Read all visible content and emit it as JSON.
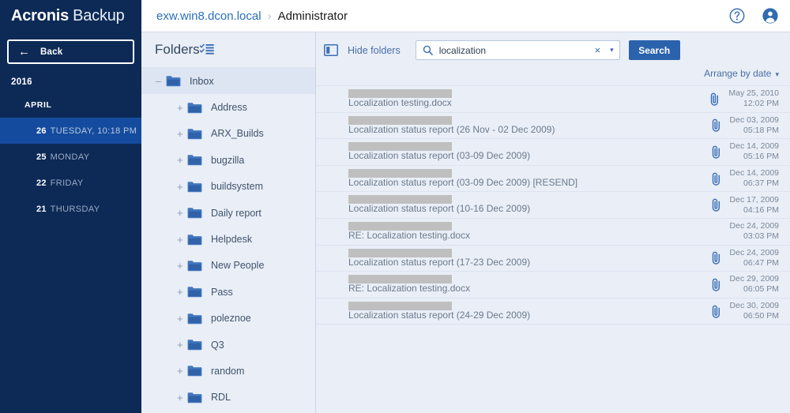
{
  "brand": {
    "name_bold": "Acronis",
    "name_light": "Backup"
  },
  "header": {
    "breadcrumb_link": "exw.win8.dcon.local",
    "breadcrumb_separator": "›",
    "breadcrumb_current": "Administrator",
    "help_icon": "question-circle-icon",
    "account_icon": "user-avatar-icon"
  },
  "sidebar": {
    "back_label": "Back",
    "back_icon": "arrow-left-icon",
    "year": "2016",
    "month": "APRIL",
    "days": [
      {
        "num": "26",
        "text": "TUESDAY, 10:18 PM",
        "selected": true
      },
      {
        "num": "25",
        "text": "MONDAY",
        "selected": false
      },
      {
        "num": "22",
        "text": "FRIDAY",
        "selected": false
      },
      {
        "num": "21",
        "text": "THURSDAY",
        "selected": false
      }
    ]
  },
  "folders": {
    "title": "Folders",
    "checklist_icon": "checklist-icon",
    "tree": [
      {
        "label": "Inbox",
        "expander": "–",
        "level": 0,
        "selected": true
      },
      {
        "label": "Address",
        "expander": "+",
        "level": 1,
        "selected": false
      },
      {
        "label": "ARX_Builds",
        "expander": "+",
        "level": 1,
        "selected": false
      },
      {
        "label": "bugzilla",
        "expander": "+",
        "level": 1,
        "selected": false
      },
      {
        "label": "buildsystem",
        "expander": "+",
        "level": 1,
        "selected": false
      },
      {
        "label": "Daily report",
        "expander": "+",
        "level": 1,
        "selected": false
      },
      {
        "label": "Helpdesk",
        "expander": "+",
        "level": 1,
        "selected": false
      },
      {
        "label": "New People",
        "expander": "+",
        "level": 1,
        "selected": false
      },
      {
        "label": "Pass",
        "expander": "+",
        "level": 1,
        "selected": false
      },
      {
        "label": "poleznoe",
        "expander": "+",
        "level": 1,
        "selected": false
      },
      {
        "label": "Q3",
        "expander": "+",
        "level": 1,
        "selected": false
      },
      {
        "label": "random",
        "expander": "+",
        "level": 1,
        "selected": false
      },
      {
        "label": "RDL",
        "expander": "+",
        "level": 1,
        "selected": false
      }
    ]
  },
  "toolbar": {
    "panel_toggle_icon": "split-panel-icon",
    "hide_folders_label": "Hide folders",
    "search_icon": "search-icon",
    "search_value": "localization",
    "search_placeholder": "Search",
    "clear_icon": "×",
    "dropdown_icon": "⌵",
    "search_button_label": "Search",
    "arrange_label": "Arrange by date",
    "arrange_caret": "⌵"
  },
  "mail": {
    "attachment_icon": "paperclip-icon",
    "rows": [
      {
        "sender_redacted": true,
        "subject": "Localization testing.docx",
        "attachment": true,
        "date": "May 25, 2010",
        "time": "12:02 PM"
      },
      {
        "sender_redacted": true,
        "subject": "Localization status report (26 Nov - 02 Dec 2009)",
        "attachment": true,
        "date": "Dec 03, 2009",
        "time": "05:18 PM"
      },
      {
        "sender_redacted": true,
        "subject": "Localization status report (03-09 Dec 2009)",
        "attachment": true,
        "date": "Dec 14, 2009",
        "time": "05:16 PM"
      },
      {
        "sender_redacted": true,
        "subject": "Localization status report (03-09 Dec 2009) [RESEND]",
        "attachment": true,
        "date": "Dec 14, 2009",
        "time": "06:37 PM"
      },
      {
        "sender_redacted": true,
        "subject": "Localization status report (10-16 Dec 2009)",
        "attachment": true,
        "date": "Dec 17, 2009",
        "time": "04:16 PM"
      },
      {
        "sender_redacted": true,
        "subject": "RE: Localization testing.docx",
        "attachment": false,
        "date": "Dec 24, 2009",
        "time": "03:03 PM"
      },
      {
        "sender_redacted": true,
        "subject": "Localization status report (17-23 Dec 2009)",
        "attachment": true,
        "date": "Dec 24, 2009",
        "time": "06:47 PM"
      },
      {
        "sender_redacted": true,
        "subject": "RE: Localization testing.docx",
        "attachment": true,
        "date": "Dec 29, 2009",
        "time": "06:05 PM"
      },
      {
        "sender_redacted": true,
        "subject": "Localization status report (24-29 Dec 2009)",
        "attachment": true,
        "date": "Dec 30, 2009",
        "time": "06:50 PM"
      }
    ]
  },
  "colors": {
    "navy": "#0d2a56",
    "navy_selected": "#144b9e",
    "accent_blue": "#2b62ac",
    "panel_bg": "#e9eef7",
    "folder_icon": "#3a6fb5",
    "link": "#4a6fa5"
  }
}
